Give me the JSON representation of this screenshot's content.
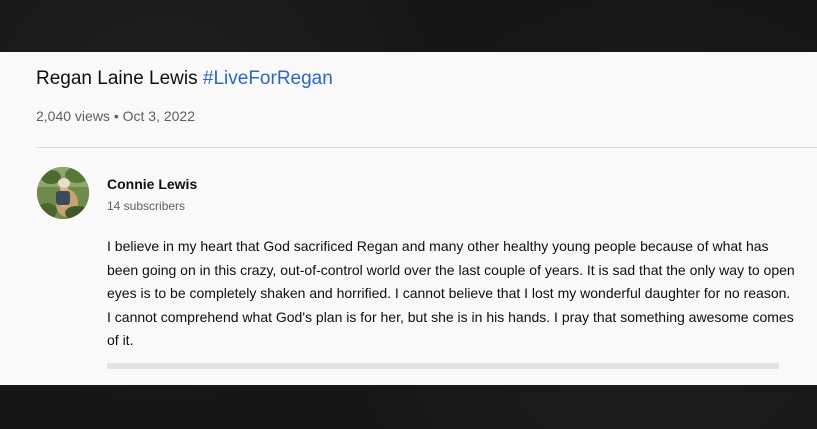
{
  "video": {
    "title": "Regan Laine Lewis",
    "hashtag": "#LiveForRegan",
    "views": "2,040 views",
    "separator": "•",
    "date": "Oct 3, 2022"
  },
  "channel": {
    "name": "Connie Lewis",
    "subscribers": "14 subscribers",
    "avatar_icon": "user-avatar-photo"
  },
  "description": "I believe in my heart that God sacrificed Regan and many other healthy young people because of what has been going on in this crazy, out-of-control world over the last couple of years. It is sad that the only way to open eyes is to be completely shaken and horrified. I cannot believe that I lost my wonderful daughter for no reason. I cannot comprehend what God's plan is for her, but she is in his hands. I pray that something awesome comes of it.",
  "colors": {
    "hashtag": "#2c66c8",
    "panel_bg": "#f9f9f9",
    "page_bg": "#161616"
  }
}
